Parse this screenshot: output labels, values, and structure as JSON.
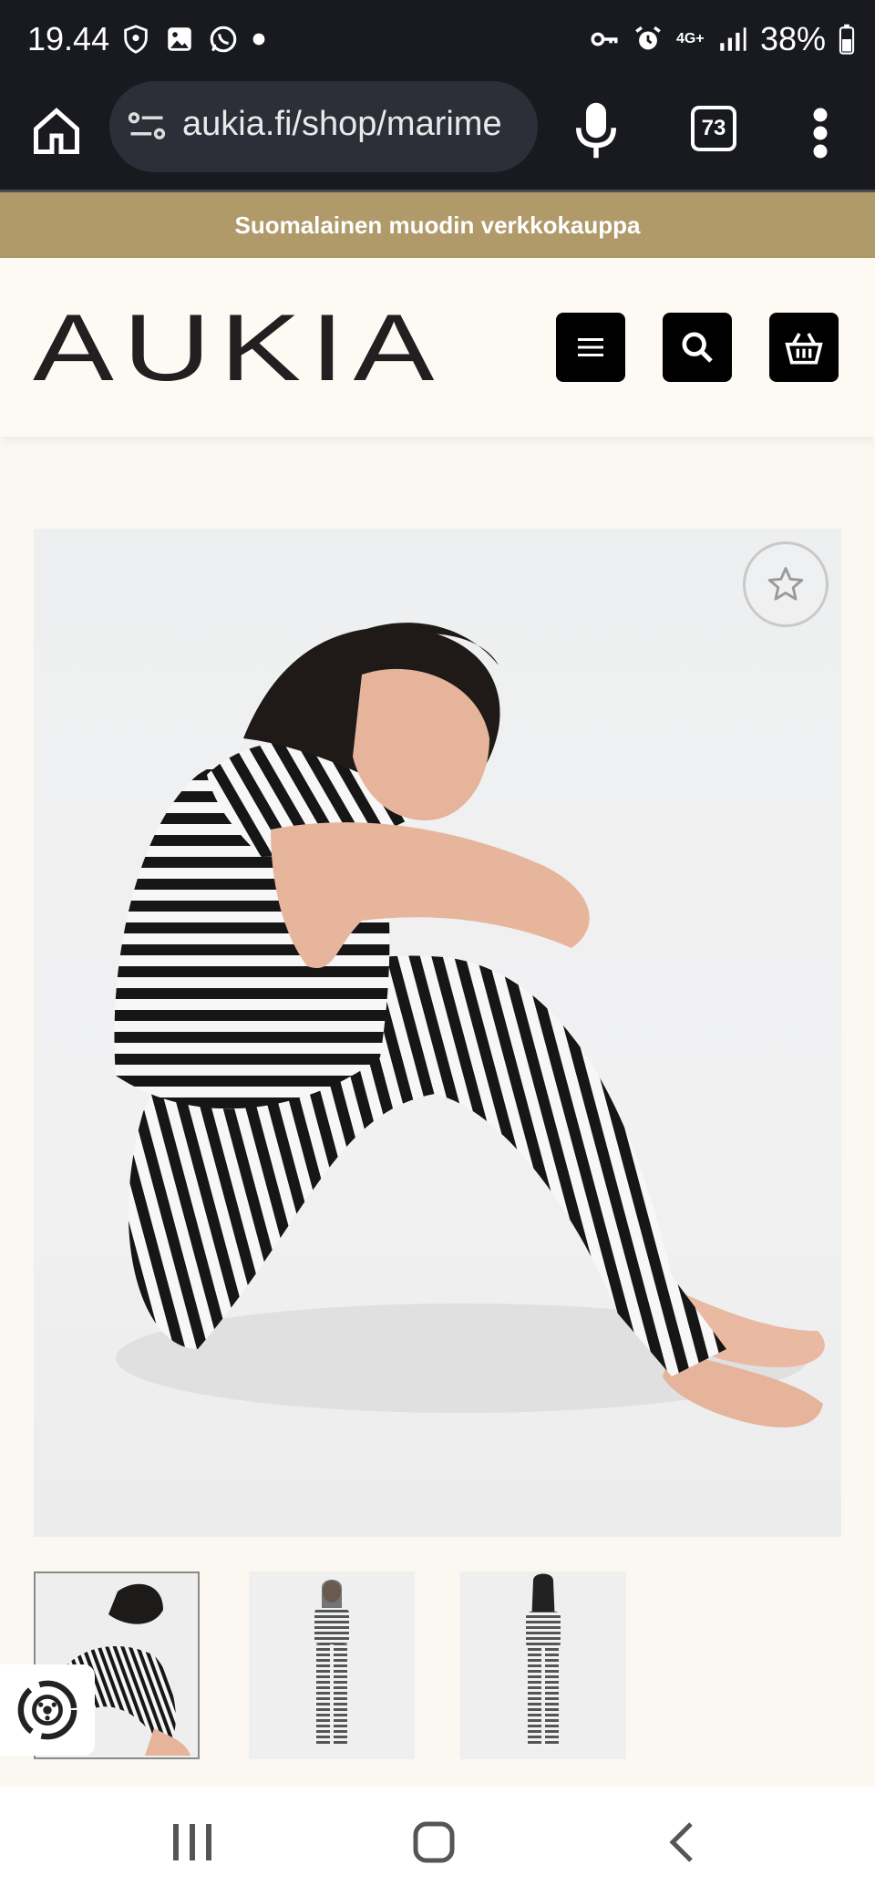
{
  "status_bar": {
    "time": "19.44",
    "battery": "38%",
    "network": "4G+"
  },
  "browser": {
    "url": "aukia.fi/shop/marime",
    "tab_count": "73"
  },
  "announcement": "Suomalainen muodin verkkokauppa",
  "header": {
    "logo": "AUKIA",
    "buttons": [
      "menu-icon",
      "search-icon",
      "basket-icon"
    ]
  },
  "product": {
    "favorite": false,
    "thumbnails": [
      "sitting-pose",
      "front-view",
      "back-view"
    ]
  },
  "colors": {
    "status_bg": "#181a20",
    "announcement_bg": "#b09a6a",
    "page_bg": "#faf8f0",
    "header_button_bg": "#000000"
  }
}
